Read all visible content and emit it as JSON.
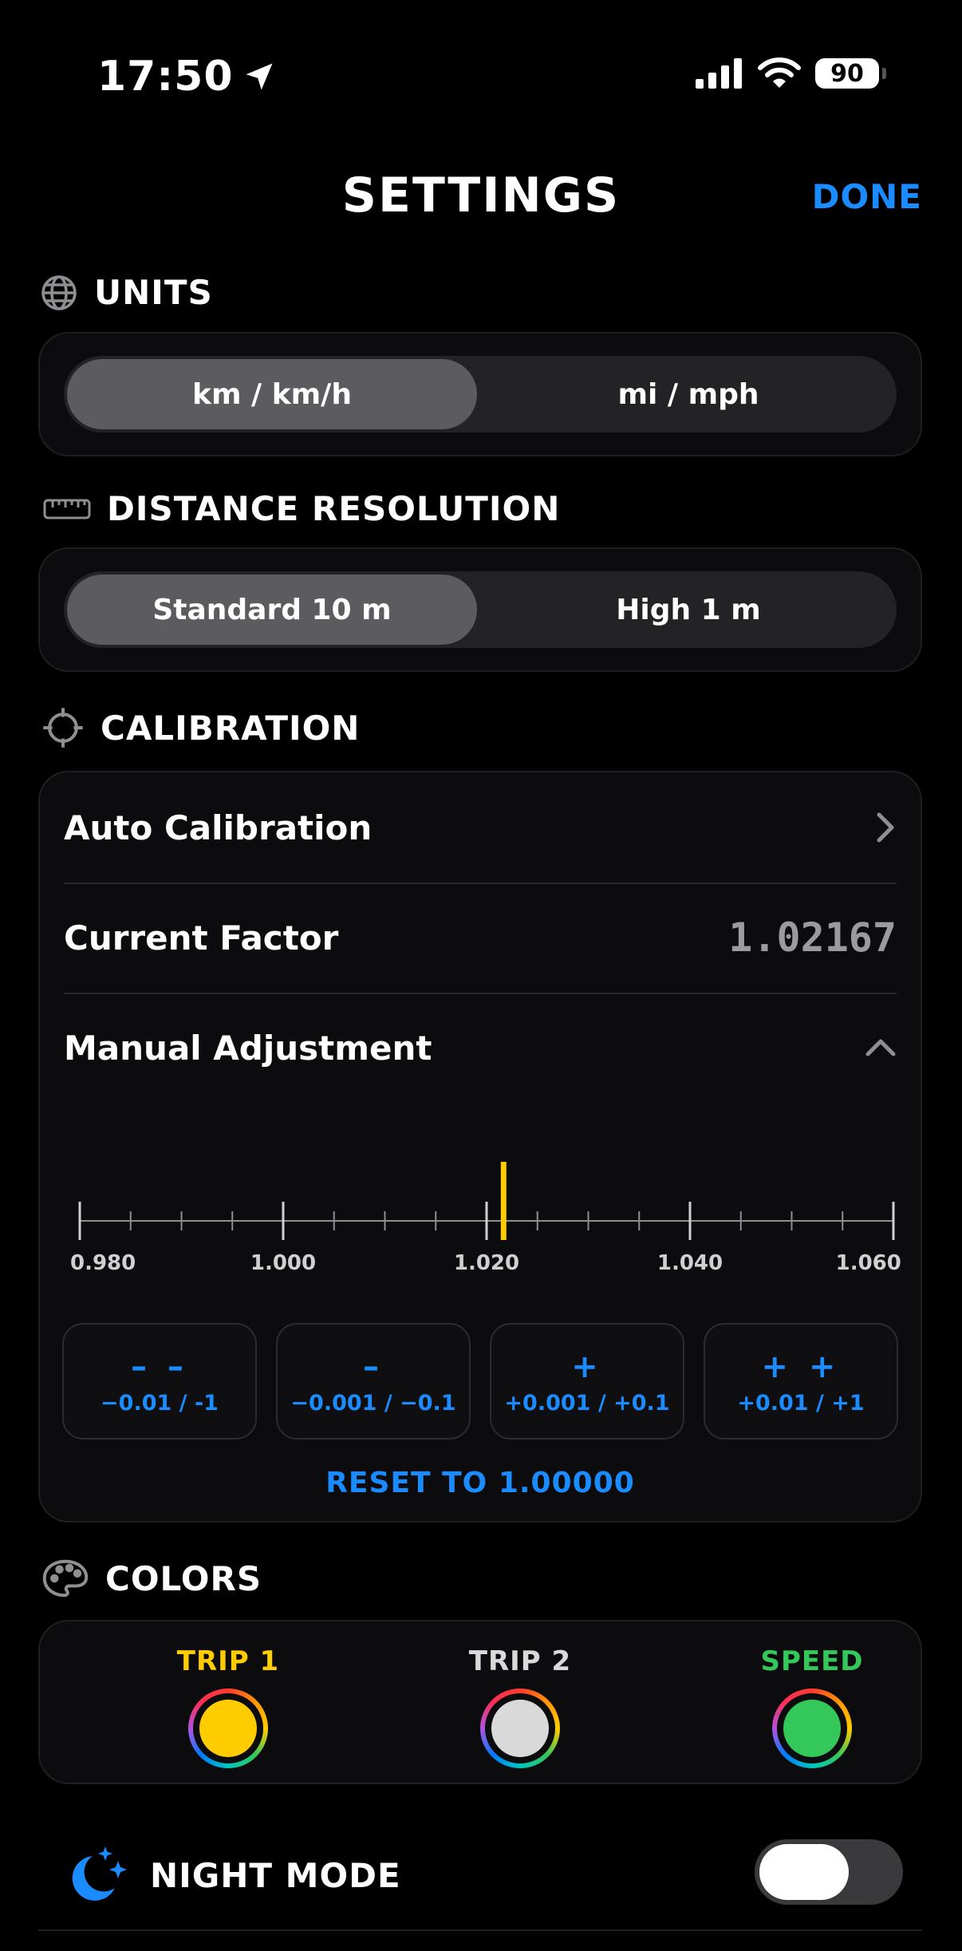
{
  "status": {
    "time": "17:50",
    "battery": "90"
  },
  "nav": {
    "title": "SETTINGS",
    "done": "DONE"
  },
  "units": {
    "header": "UNITS",
    "options": [
      "km / km/h",
      "mi / mph"
    ],
    "selected": 0
  },
  "resolution": {
    "header": "DISTANCE RESOLUTION",
    "options": [
      "Standard 10 m",
      "High 1 m"
    ],
    "selected": 0
  },
  "calibration": {
    "header": "CALIBRATION",
    "auto_label": "Auto Calibration",
    "factor_label": "Current Factor",
    "factor_value": "1.02167",
    "manual_label": "Manual Adjustment",
    "ruler": {
      "min": 0.98,
      "max": 1.06,
      "current": 1.02167,
      "labels": [
        "0.980",
        "1.000",
        "1.020",
        "1.040",
        "1.060"
      ],
      "accent": "#ffcc00"
    },
    "steps": [
      {
        "symbol": "– –",
        "label": "−0.01 / -1"
      },
      {
        "symbol": "–",
        "label": "−0.001 / −0.1"
      },
      {
        "symbol": "+",
        "label": "+0.001 / +0.1"
      },
      {
        "symbol": "+ +",
        "label": "+0.01 / +1"
      }
    ],
    "reset": "RESET TO 1.00000"
  },
  "colors": {
    "header": "COLORS",
    "items": [
      {
        "name": "TRIP 1",
        "color": "#ffcc00"
      },
      {
        "name": "TRIP 2",
        "color": "#d9d9d9"
      },
      {
        "name": "SPEED",
        "color": "#34c759"
      }
    ]
  },
  "night_mode": {
    "label": "NIGHT MODE",
    "enabled": true
  },
  "accent": "#1a8cff"
}
